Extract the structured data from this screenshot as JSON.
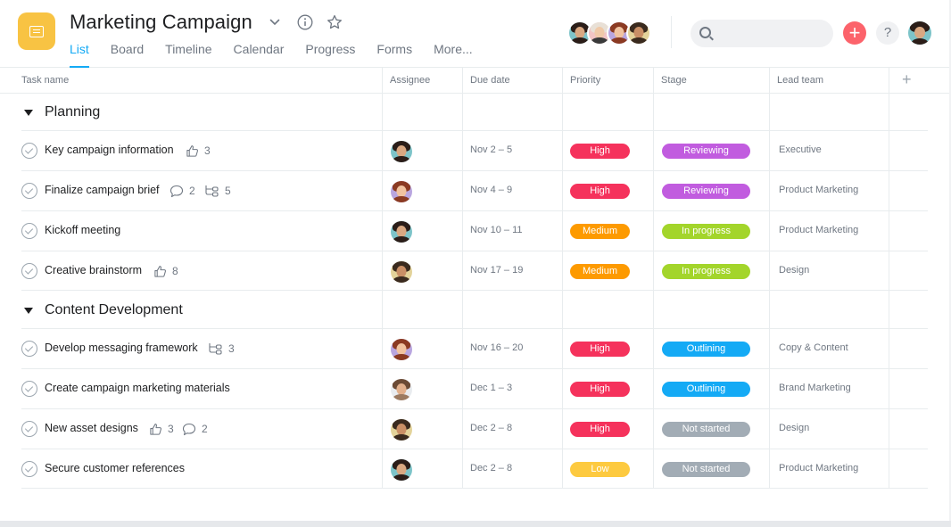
{
  "header": {
    "title": "Marketing Campaign",
    "tabs": [
      "List",
      "Board",
      "Timeline",
      "Calendar",
      "Progress",
      "Forms",
      "More..."
    ],
    "active_tab": "List",
    "search_placeholder": "",
    "add_label": "+",
    "help_label": "?"
  },
  "columns": {
    "task": "Task name",
    "assignee": "Assignee",
    "due": "Due date",
    "priority": "Priority",
    "stage": "Stage",
    "lead": "Lead team",
    "add": "+"
  },
  "colors": {
    "accent": "#14aaf5",
    "project_icon": "#f8c343",
    "add_button": "#fc636b",
    "priority_high": "#f5325c",
    "priority_medium": "#fd9a00",
    "priority_low": "#fdca40",
    "stage_reviewing": "#c15cdf",
    "stage_in_progress": "#a3d52b",
    "stage_outlining": "#14aaf5",
    "stage_not_started": "#a2acb5"
  },
  "sections": [
    {
      "name": "Planning",
      "tasks": [
        {
          "name": "Key campaign information",
          "likes": "3",
          "comments": "",
          "subtasks": "",
          "due": "Nov 2 – 5",
          "priority": "High",
          "stage": "Reviewing",
          "lead": "Executive",
          "avatar": "woman-dark-hair"
        },
        {
          "name": "Finalize campaign brief",
          "likes": "",
          "comments": "2",
          "subtasks": "5",
          "due": "Nov 4 – 9",
          "priority": "High",
          "stage": "Reviewing",
          "lead": "Product Marketing",
          "avatar": "woman-red-hair"
        },
        {
          "name": "Kickoff meeting",
          "likes": "",
          "comments": "",
          "subtasks": "",
          "due": "Nov 10 – 11",
          "priority": "Medium",
          "stage": "In progress",
          "lead": "Product Marketing",
          "avatar": "woman-dark-hair"
        },
        {
          "name": "Creative brainstorm",
          "likes": "8",
          "comments": "",
          "subtasks": "",
          "due": "Nov 17 – 19",
          "priority": "Medium",
          "stage": "In progress",
          "lead": "Design",
          "avatar": "man-beard"
        }
      ]
    },
    {
      "name": "Content Development",
      "tasks": [
        {
          "name": "Develop messaging framework",
          "likes": "",
          "comments": "",
          "subtasks": "3",
          "due": "Nov 16 – 20",
          "priority": "High",
          "stage": "Outlining",
          "lead": "Copy & Content",
          "avatar": "woman-red-hair"
        },
        {
          "name": "Create campaign marketing materials",
          "likes": "",
          "comments": "",
          "subtasks": "",
          "due": "Dec 1 – 3",
          "priority": "High",
          "stage": "Outlining",
          "lead": "Brand Marketing",
          "avatar": "man-light"
        },
        {
          "name": "New asset designs",
          "likes": "3",
          "comments": "2",
          "subtasks": "",
          "due": "Dec 2 – 8",
          "priority": "High",
          "stage": "Not started",
          "lead": "Design",
          "avatar": "man-beard"
        },
        {
          "name": "Secure customer references",
          "likes": "",
          "comments": "",
          "subtasks": "",
          "due": "Dec 2 – 8",
          "priority": "Low",
          "stage": "Not started",
          "lead": "Product Marketing",
          "avatar": "woman-dark-hair"
        }
      ]
    }
  ]
}
